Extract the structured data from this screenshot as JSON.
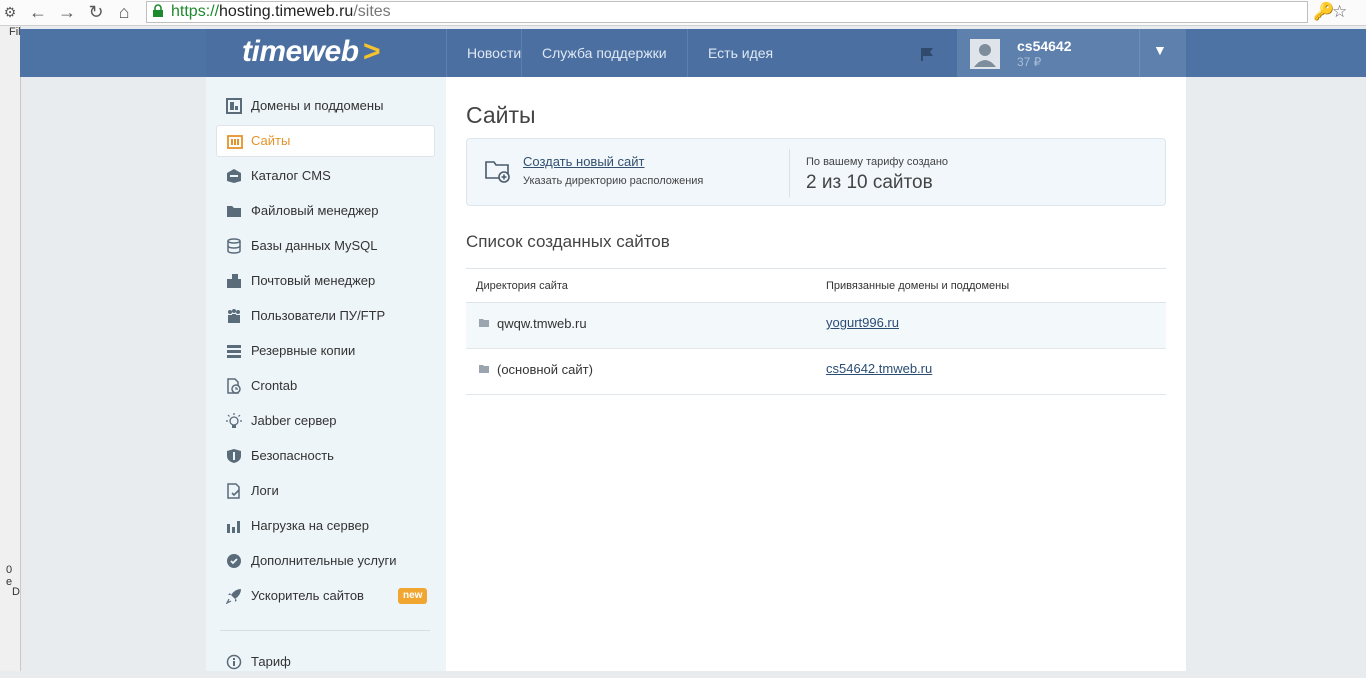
{
  "browser": {
    "url_scheme": "https://",
    "url_host": "hosting.timeweb.ru",
    "url_path": "/sites",
    "left_strip_labels": [
      "Fil",
      "0 e",
      "D"
    ]
  },
  "header": {
    "logo_text": "timeweb",
    "logo_arrow": ">",
    "nav": [
      "Новости",
      "Служба поддержки",
      "Есть идея"
    ],
    "username": "cs54642",
    "balance": "37 ₽",
    "colors": {
      "header_bg": "#4a6fa0",
      "logo_accent": "#f5c32d",
      "active_menu": "#e4932b"
    }
  },
  "sidebar": {
    "items": [
      {
        "label": "Домены и поддомены",
        "icon": "domains-icon"
      },
      {
        "label": "Сайты",
        "icon": "sites-icon",
        "active": true
      },
      {
        "label": "Каталог CMS",
        "icon": "cms-box-icon"
      },
      {
        "label": "Файловый менеджер",
        "icon": "folder-icon"
      },
      {
        "label": "Базы данных MySQL",
        "icon": "database-icon"
      },
      {
        "label": "Почтовый менеджер",
        "icon": "mail-icon"
      },
      {
        "label": "Пользователи ПУ/FTP",
        "icon": "users-icon"
      },
      {
        "label": "Резервные копии",
        "icon": "backup-icon"
      },
      {
        "label": "Crontab",
        "icon": "clock-file-icon"
      },
      {
        "label": "Jabber сервер",
        "icon": "bulb-icon"
      },
      {
        "label": "Безопасность",
        "icon": "shield-icon"
      },
      {
        "label": "Логи",
        "icon": "log-icon"
      },
      {
        "label": "Нагрузка на сервер",
        "icon": "bar-chart-icon"
      },
      {
        "label": "Дополнительные услуги",
        "icon": "gear-badge-icon"
      },
      {
        "label": "Ускоритель сайтов",
        "icon": "rocket-icon",
        "badge": "new"
      }
    ],
    "bottom_item": {
      "label": "Тариф",
      "icon": "info-icon"
    }
  },
  "main": {
    "title": "Сайты",
    "create_link": "Создать новый сайт",
    "create_sub": "Указать директорию расположения",
    "quota_label": "По вашему тарифу создано",
    "quota_value": "2 из 10 сайтов",
    "list_title": "Список созданных сайтов",
    "columns": [
      "Директория сайта",
      "Привязанные домены и поддомены"
    ],
    "rows": [
      {
        "dir": "qwqw.tmweb.ru",
        "domain": "yogurt996.ru"
      },
      {
        "dir": "(основной сайт)",
        "domain": "cs54642.tmweb.ru"
      }
    ]
  }
}
